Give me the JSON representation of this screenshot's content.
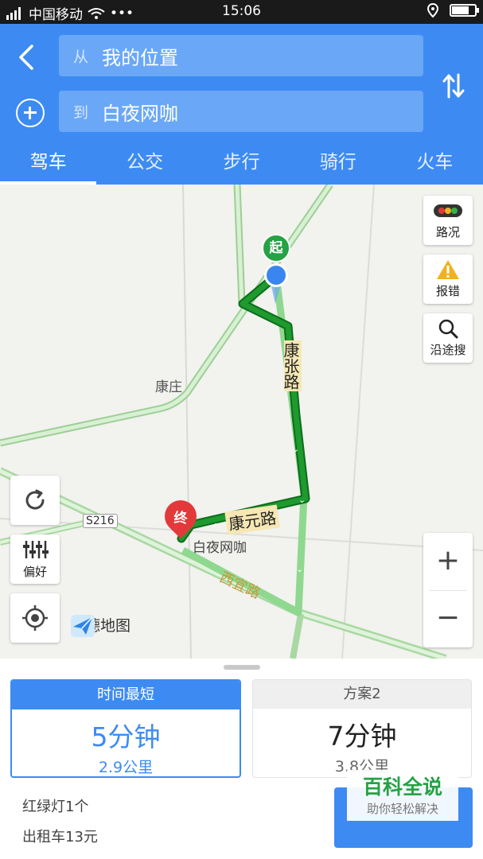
{
  "status_bar": {
    "carrier": "中国移动",
    "time": "15:06",
    "battery_level": 0.75
  },
  "header": {
    "from_prefix": "从",
    "from_value": "我的位置",
    "to_prefix": "到",
    "to_value": "白夜网咖",
    "icons": {
      "back": "back-arrow-icon",
      "add": "add-waypoint-icon",
      "swap": "swap-icon"
    }
  },
  "tabs": [
    {
      "label": "驾车",
      "active": true
    },
    {
      "label": "公交",
      "active": false
    },
    {
      "label": "步行",
      "active": false
    },
    {
      "label": "骑行",
      "active": false
    },
    {
      "label": "火车",
      "active": false
    }
  ],
  "map": {
    "place_kangzhuang": "康庄",
    "road_s216": "S216",
    "road_kangzhang": "康张路",
    "road_kangyuan": "康元路",
    "road_xiyi": "西宜路",
    "destination_name": "白夜网咖",
    "start_marker": "起",
    "end_marker": "终",
    "route_color": "#1e9a2e",
    "alt_route_color": "#8fd88f",
    "brand": "高德地图",
    "controls": {
      "traffic": "路况",
      "report_error": "报错",
      "search_along": "沿途搜",
      "preference": "偏好",
      "zoom_in": "+",
      "zoom_out": "−"
    }
  },
  "routes": [
    {
      "tag": "时间最短",
      "duration": "5分钟",
      "distance": "2.9公里",
      "selected": true
    },
    {
      "tag": "方案2",
      "duration": "7分钟",
      "distance": "3.8公里",
      "selected": false
    }
  ],
  "route_info": {
    "traffic_lights": "红绿灯1个",
    "taxi_fare": "出租车13元"
  },
  "watermark": {
    "title": "百科全说",
    "subtitle": "助你轻松解决"
  },
  "colors": {
    "accent": "#3d8bf2"
  }
}
